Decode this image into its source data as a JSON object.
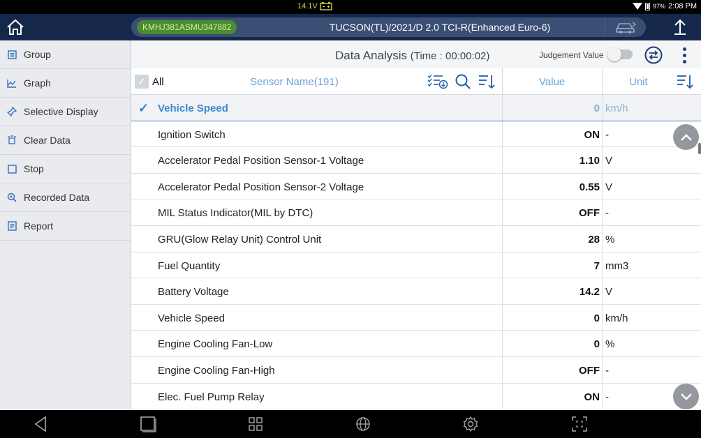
{
  "status_bar": {
    "voltage": "14.1V",
    "battery_percent": "97%",
    "clock": "2:08 PM"
  },
  "header": {
    "vin": "KMHJ381ASMU347882",
    "vehicle": "TUCSON(TL)/2021/D 2.0 TCI-R(Enhanced Euro-6)"
  },
  "sidebar": {
    "items": [
      {
        "label": "Group",
        "icon": "group-icon"
      },
      {
        "label": "Graph",
        "icon": "graph-icon"
      },
      {
        "label": "Selective Display",
        "icon": "pin-icon"
      },
      {
        "label": "Clear Data",
        "icon": "clear-icon"
      },
      {
        "label": "Stop",
        "icon": "stop-icon"
      },
      {
        "label": "Recorded Data",
        "icon": "recorded-icon"
      },
      {
        "label": "Report",
        "icon": "report-icon"
      }
    ]
  },
  "titlebar": {
    "title": "Data Analysis",
    "time": "(Time : 00:00:02)",
    "judgement_label": "Judgement Value",
    "judgement_on": false
  },
  "columns": {
    "all_label": "All",
    "sensor_name": "Sensor Name(191)",
    "value": "Value",
    "unit": "Unit"
  },
  "rows": [
    {
      "name": "Vehicle Speed",
      "value": "0",
      "unit": "km/h",
      "selected": true
    },
    {
      "name": "Ignition Switch",
      "value": "ON",
      "unit": "-"
    },
    {
      "name": "Accelerator Pedal Position Sensor-1 Voltage",
      "value": "1.10",
      "unit": "V"
    },
    {
      "name": "Accelerator Pedal Position Sensor-2 Voltage",
      "value": "0.55",
      "unit": "V"
    },
    {
      "name": "MIL Status Indicator(MIL by DTC)",
      "value": "OFF",
      "unit": "-"
    },
    {
      "name": "GRU(Glow Relay Unit) Control Unit",
      "value": "28",
      "unit": "%"
    },
    {
      "name": "Fuel Quantity",
      "value": "7",
      "unit": "mm3"
    },
    {
      "name": "Battery Voltage",
      "value": "14.2",
      "unit": "V"
    },
    {
      "name": "Vehicle Speed",
      "value": "0",
      "unit": "km/h"
    },
    {
      "name": "Engine Cooling Fan-Low",
      "value": "0",
      "unit": "%"
    },
    {
      "name": "Engine Cooling Fan-High",
      "value": "OFF",
      "unit": "-"
    },
    {
      "name": "Elec. Fuel Pump Relay",
      "value": "ON",
      "unit": "-"
    }
  ],
  "colors": {
    "header_bg": "#15284c",
    "accent_blue": "#2f6fb7",
    "vin_badge_bg": "#4a8c34"
  }
}
